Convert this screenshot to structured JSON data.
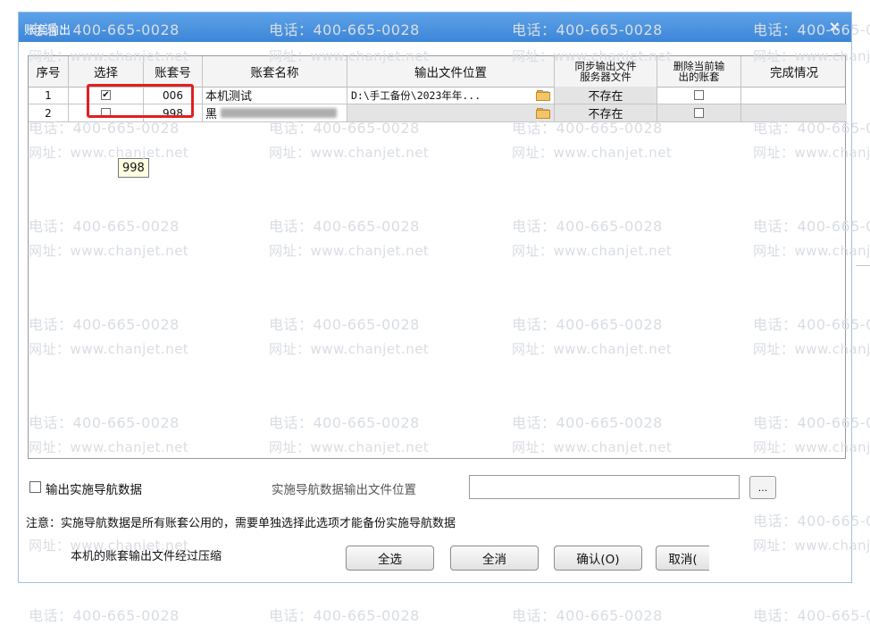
{
  "dialog": {
    "title": "账套输出",
    "close_glyph": "×"
  },
  "columns": [
    "序号",
    "选择",
    "账套号",
    "账套名称",
    "输出文件位置",
    "同步输出文件服务器文件",
    "删除当前输出的账套",
    "完成情况"
  ],
  "columns_split": {
    "sync": [
      "同步输出文件",
      "服务器文件"
    ],
    "delete": [
      "删除当前输",
      "出的账套"
    ]
  },
  "rows": [
    {
      "seq": "1",
      "selected": true,
      "code": "006",
      "name": "本机测试",
      "path": "D:\\手工备份\\2023年年...",
      "server_file": "不存在",
      "delete_current": false,
      "status": ""
    },
    {
      "seq": "2",
      "selected": false,
      "code": "998",
      "name": "黑",
      "path": "",
      "server_file": "不存在",
      "delete_current": false,
      "status": ""
    }
  ],
  "tooltip": "998",
  "impl_nav": {
    "checkbox_label": "输出实施导航数据",
    "checked": false,
    "path_label": "实施导航数据输出文件位置",
    "path_value": "",
    "browse_label": "..."
  },
  "note": "注意：实施导航数据是所有账套公用的，需要单独选择此选项才能备份实施导航数据",
  "compress_text": "本机的账套输出文件经过压缩",
  "buttons": {
    "select_all": "全选",
    "deselect_all": "全消",
    "confirm": "确认(O)",
    "cancel": "取消("
  },
  "watermark": {
    "phone": "电话：400-665-0028",
    "site": "网址：www.chanjet.net"
  },
  "checkbox_glyph": "✔",
  "colors": {
    "titlebar": "#4a93e0",
    "highlight_box": "#e02020",
    "tooltip_bg": "#ffffe1"
  }
}
